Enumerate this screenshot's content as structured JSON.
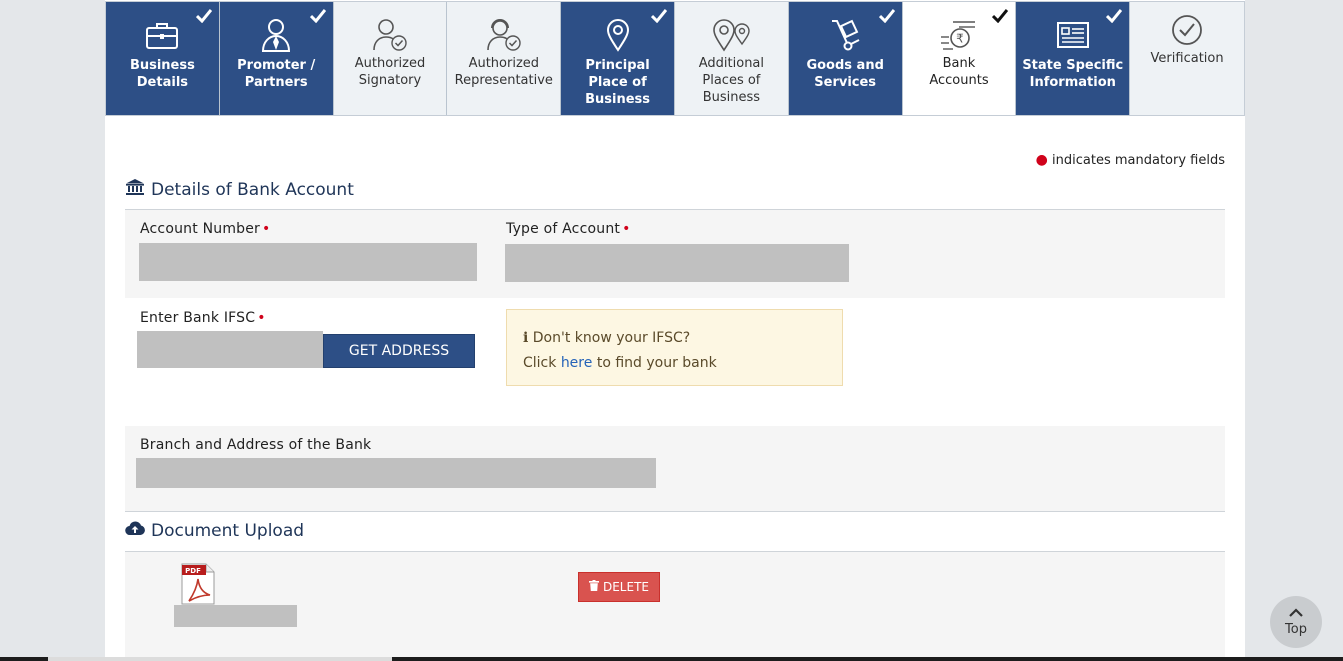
{
  "tabs": [
    {
      "label": "Business\nDetails",
      "icon": "briefcase-icon",
      "state": "done"
    },
    {
      "label": "Promoter /\nPartners",
      "icon": "person-icon",
      "state": "done"
    },
    {
      "label": "Authorized\nSignatory",
      "icon": "person-check-icon",
      "state": "pending"
    },
    {
      "label": "Authorized\nRepresentative",
      "icon": "headset-person-icon",
      "state": "pending"
    },
    {
      "label": "Principal\nPlace of\nBusiness",
      "icon": "map-pin-icon",
      "state": "done"
    },
    {
      "label": "Additional\nPlaces of\nBusiness",
      "icon": "map-pins-icon",
      "state": "pending"
    },
    {
      "label": "Goods and\nServices",
      "icon": "hand-truck-icon",
      "state": "done"
    },
    {
      "label": "Bank\nAccounts",
      "icon": "rupee-coin-icon",
      "state": "active"
    },
    {
      "label": "State Specific\nInformation",
      "icon": "id-card-icon",
      "state": "done"
    },
    {
      "label": "Verification",
      "icon": "check-circle-icon",
      "state": "pending"
    }
  ],
  "mandatory_note": "indicates mandatory fields",
  "bank_section": {
    "title": "Details of Bank Account",
    "account_number_label": "Account Number",
    "account_type_label": "Type of Account",
    "ifsc_label": "Enter Bank IFSC",
    "get_address_label": "GET ADDRESS",
    "ifsc_help_line1": "Don't know your IFSC?",
    "ifsc_help_click": "Click",
    "ifsc_help_link": "here",
    "ifsc_help_rest": "to find your bank",
    "branch_label": "Branch and Address of the Bank"
  },
  "document_section": {
    "title": "Document Upload",
    "file_icon_text": "PDF",
    "delete_label": "DELETE"
  },
  "top_button_label": "Top",
  "colors": {
    "primary": "#2d4f86",
    "required": "#d0021b",
    "danger": "#d9534f"
  }
}
